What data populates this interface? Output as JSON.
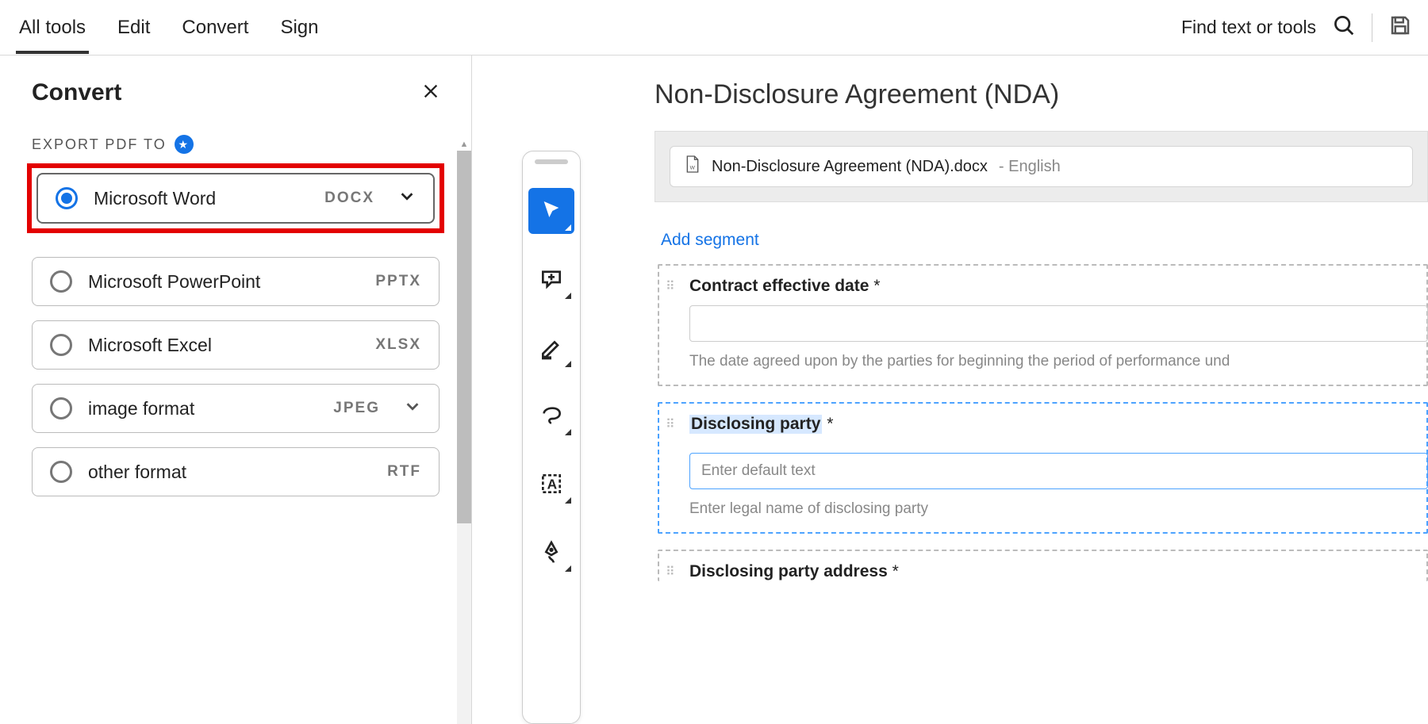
{
  "topbar": {
    "items": [
      "All tools",
      "Edit",
      "Convert",
      "Sign"
    ],
    "active_index": 0,
    "find_placeholder": "Find text or tools"
  },
  "left_panel": {
    "title": "Convert",
    "section_label": "EXPORT PDF TO",
    "options": [
      {
        "label": "Microsoft Word",
        "ext": "DOCX",
        "selected": true,
        "has_chevron": true,
        "highlighted": true
      },
      {
        "label": "Microsoft PowerPoint",
        "ext": "PPTX",
        "selected": false,
        "has_chevron": false
      },
      {
        "label": "Microsoft Excel",
        "ext": "XLSX",
        "selected": false,
        "has_chevron": false
      },
      {
        "label": "image format",
        "ext": "JPEG",
        "selected": false,
        "has_chevron": true
      },
      {
        "label": "other format",
        "ext": "RTF",
        "selected": false,
        "has_chevron": false
      }
    ]
  },
  "toolbar_icons": [
    "cursor",
    "comment",
    "highlight",
    "lasso",
    "text-select",
    "pen"
  ],
  "document": {
    "title": "Non-Disclosure Agreement (NDA)",
    "filename": "Non-Disclosure Agreement (NDA).docx",
    "language_suffix": " - English",
    "add_segment_label": "Add segment",
    "segments": [
      {
        "label": "Contract effective date",
        "required": true,
        "help": "The date agreed upon by the parties for beginning the period of performance und",
        "selected": false,
        "placeholder": ""
      },
      {
        "label": "Disclosing party",
        "required": true,
        "help": "Enter legal name of disclosing party",
        "selected": true,
        "placeholder": "Enter default text"
      },
      {
        "label": "Disclosing party address",
        "required": true,
        "help": "",
        "selected": false,
        "placeholder": ""
      }
    ]
  }
}
